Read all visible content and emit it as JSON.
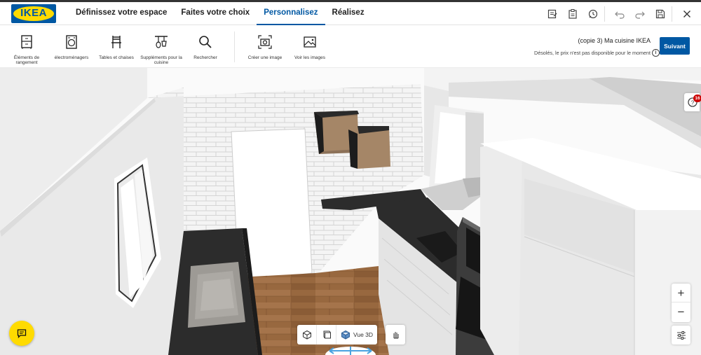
{
  "nav": {
    "logo_text": "IKEA",
    "tabs": [
      {
        "label": "Définissez votre espace"
      },
      {
        "label": "Faites votre choix"
      },
      {
        "label": "Personnalisez"
      },
      {
        "label": "Réalisez"
      }
    ],
    "active_tab": "Personnalisez",
    "right_icons": [
      "notes-icon",
      "clipboard-icon",
      "history-icon",
      "undo-icon",
      "redo-icon",
      "save-icon",
      "close-icon"
    ]
  },
  "toolbar": {
    "tools": [
      {
        "label": "Éléments de rangement",
        "icon": "cabinet-icon"
      },
      {
        "label": "électroménagers",
        "icon": "washing-machine-icon"
      },
      {
        "label": "Tables et chaises",
        "icon": "chair-icon"
      },
      {
        "label": "Suppléments pour la cuisine",
        "icon": "kitchen-utensils-icon"
      },
      {
        "label": "Rechercher",
        "icon": "search-icon"
      },
      {
        "label": "Créer une image",
        "icon": "camera-icon"
      },
      {
        "label": "Voir les images",
        "icon": "image-icon"
      }
    ],
    "project_name": "(copie 3) Ma cuisine IKEA",
    "price_warning": "Désolés, le prix n'est pas disponible pour le moment",
    "next_label": "Suivant"
  },
  "viewport": {
    "help_badge": "16",
    "zoom_in": "+",
    "zoom_out": "−",
    "view_mode_label": "Vue 3D"
  },
  "colors": {
    "brand_blue": "#0058a3",
    "brand_yellow": "#ffdb00",
    "badge_red": "#cc0000",
    "countertop": "#2b2b2b",
    "floor_wood": "#9a6a44",
    "cabinet_oak": "#a58667"
  }
}
